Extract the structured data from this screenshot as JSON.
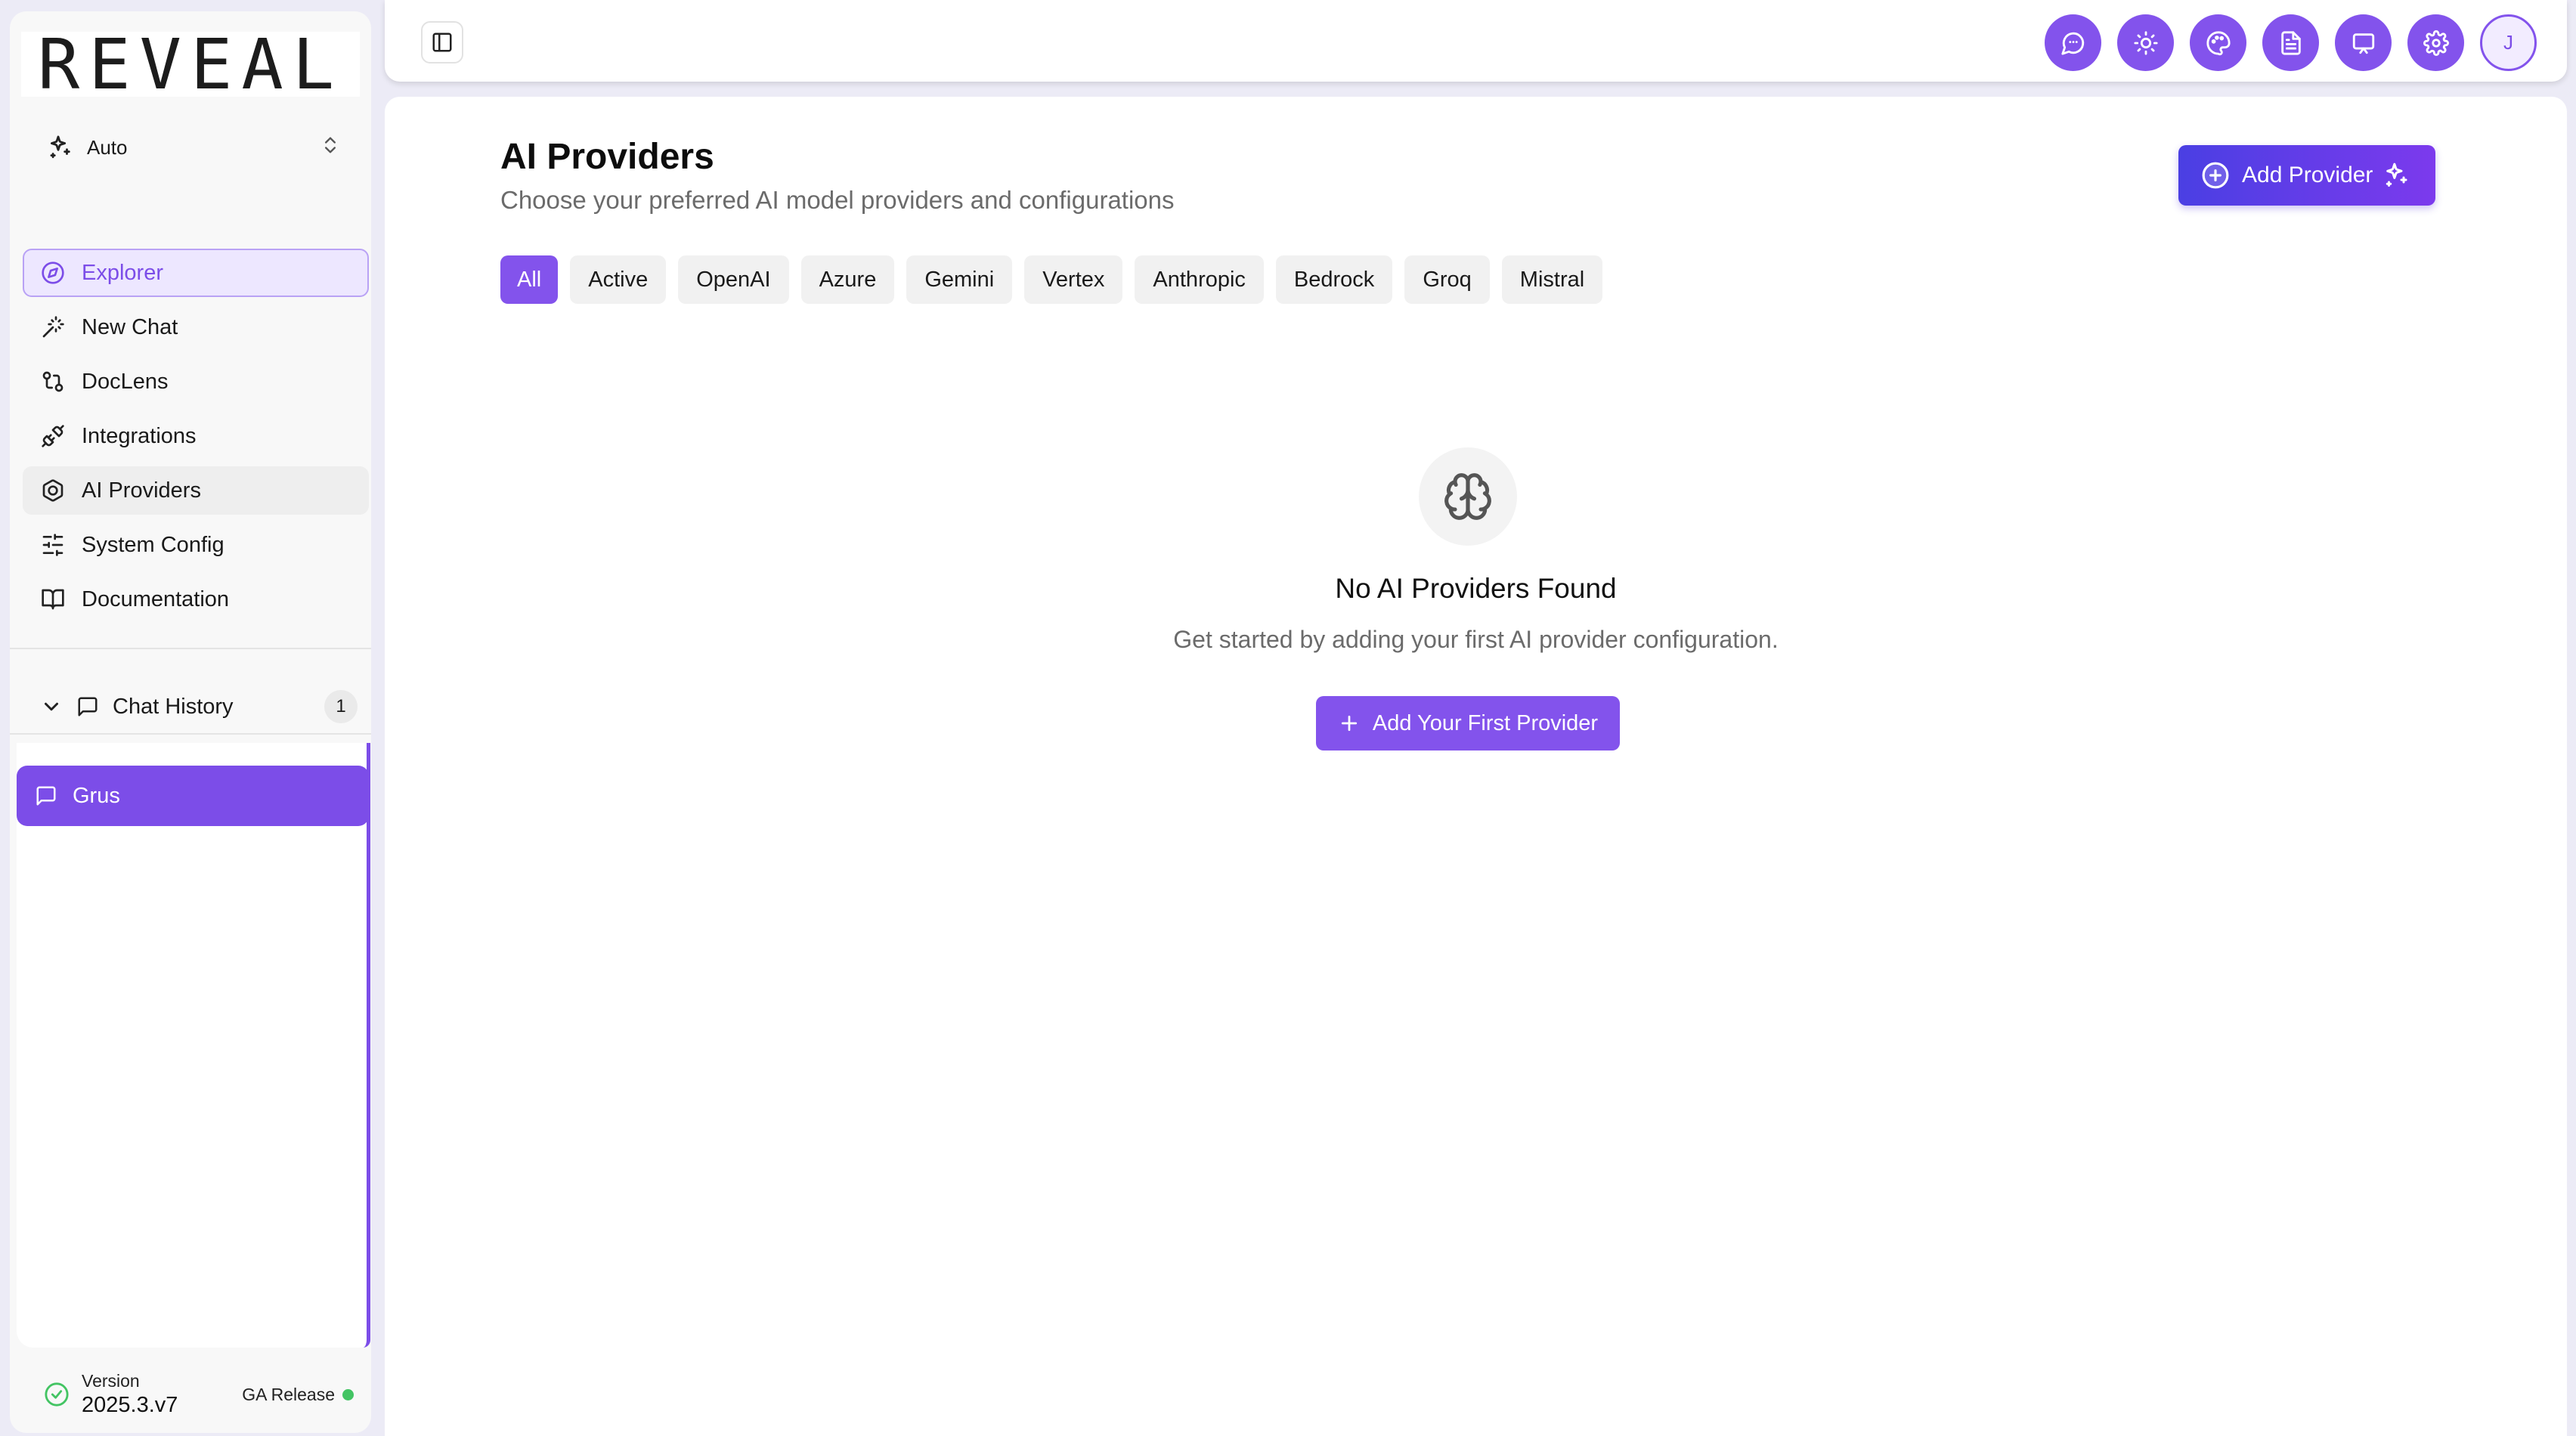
{
  "brand": {
    "logo_text": "REVEAL",
    "accent_color": "#7C4DE8"
  },
  "sidebar": {
    "mode": {
      "label": "Auto",
      "icon": "sparkles-icon"
    },
    "nav": [
      {
        "label": "Explorer",
        "icon": "compass-icon",
        "state": "active"
      },
      {
        "label": "New Chat",
        "icon": "magic-wand-icon"
      },
      {
        "label": "DocLens",
        "icon": "git-compare-icon"
      },
      {
        "label": "Integrations",
        "icon": "plug-icon"
      },
      {
        "label": "AI Providers",
        "icon": "hexagon-icon",
        "state": "hover"
      },
      {
        "label": "System Config",
        "icon": "sliders-icon"
      },
      {
        "label": "Documentation",
        "icon": "book-open-icon"
      }
    ],
    "chat_history": {
      "label": "Chat History",
      "count": "1",
      "items": [
        {
          "label": "Grus",
          "icon": "message-square-icon"
        }
      ]
    },
    "version": {
      "label": "Version",
      "number": "2025.3.v7",
      "release": "GA Release",
      "status_color": "#43C463"
    }
  },
  "topbar": {
    "actions": [
      "chat-bubble-icon",
      "sun-icon",
      "palette-icon",
      "document-icon",
      "monitor-message-icon",
      "gear-icon"
    ],
    "avatar_initial": "J"
  },
  "main": {
    "title": "AI Providers",
    "subtitle": "Choose your preferred AI model providers and configurations",
    "add_button": "Add Provider",
    "filters": [
      "All",
      "Active",
      "OpenAI",
      "Azure",
      "Gemini",
      "Vertex",
      "Anthropic",
      "Bedrock",
      "Groq",
      "Mistral"
    ],
    "selected_filter": "All",
    "empty_state": {
      "icon": "brain-icon",
      "title": "No AI Providers Found",
      "text": "Get started by adding your first AI provider configuration.",
      "button": "Add Your First Provider"
    }
  }
}
